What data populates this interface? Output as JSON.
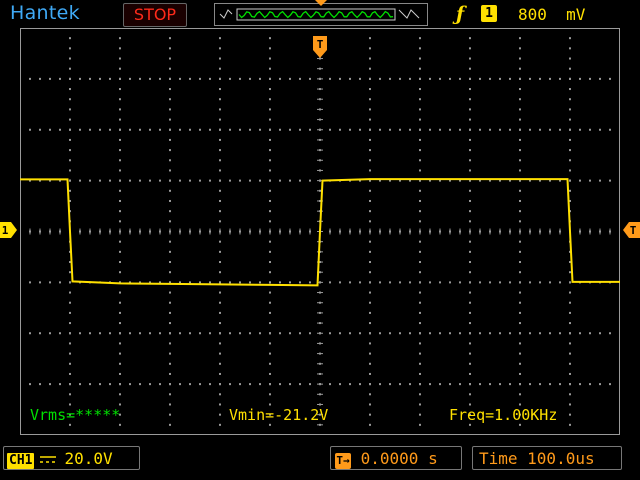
{
  "header": {
    "brand": "Hantek",
    "run_state": "STOP",
    "trigger": {
      "slope_icon": "rising-edge-icon",
      "source_channel": "1",
      "level": "800  mV"
    }
  },
  "colors": {
    "channel1": "#ffe000",
    "trigger": "#ff9a1a",
    "stop": "#ff2a1a",
    "brand": "#3fa9f5",
    "rms": "#00e000",
    "grid": "#9a9a9a"
  },
  "markers": {
    "channel_marker_label": "1",
    "trigger_pos_label": "T"
  },
  "measurements": {
    "vrms": "Vrms=*****",
    "vmin": "Vmin=-21.2V",
    "freq": "Freq=1.00KHz"
  },
  "footer": {
    "channel_label": "CH1",
    "coupling_icon": "dc-coupling-icon",
    "volts_per_div": "20.0V",
    "trigger_position": "0.0000 s",
    "timebase": "Time 100.0us"
  },
  "chart_data": {
    "type": "line",
    "title": "",
    "xlabel": "",
    "ylabel": "",
    "volts_per_div": 20.0,
    "time_per_div_us": 100.0,
    "xlim": [
      -600,
      600
    ],
    "ylim": [
      -80,
      80
    ],
    "series": [
      {
        "x": [
          -600,
          -505,
          -500,
          -495,
          -400,
          -300,
          -200,
          -100,
          -5,
          0,
          5,
          100,
          200,
          300,
          400,
          495,
          500,
          505,
          600
        ],
        "values": [
          20.5,
          20.5,
          0,
          -19.6,
          -20.4,
          -20.6,
          -20.8,
          -21.0,
          -21.2,
          0,
          20.0,
          20.6,
          20.6,
          20.6,
          20.6,
          20.6,
          0,
          -19.8,
          -19.8
        ]
      }
    ]
  }
}
